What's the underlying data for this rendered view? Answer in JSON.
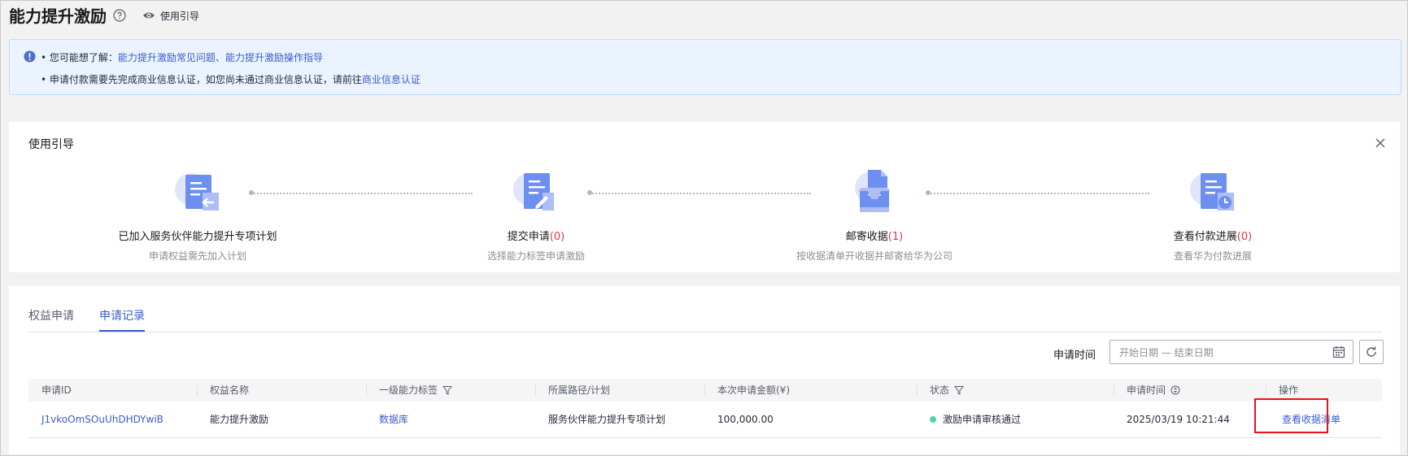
{
  "header": {
    "title": "能力提升激励",
    "guide_link": "使用引导"
  },
  "banner": {
    "line1_prefix": "• 您可能想了解：",
    "link_faq": "能力提升激励常见问题",
    "separator": "、",
    "link_guide": "能力提升激励操作指导",
    "line2_prefix": "• 申请付款需要先完成商业信息认证，如您尚未通过商业信息认证，请前往",
    "link_cert": "商业信息认证"
  },
  "guide": {
    "title": "使用引导",
    "steps": [
      {
        "title": "已加入服务伙伴能力提升专项计划",
        "count": "",
        "desc": "申请权益需先加入计划",
        "icon": "document-return-icon"
      },
      {
        "title": "提交申请",
        "count": "(0)",
        "desc": "选择能力标签申请激励",
        "icon": "document-edit-icon"
      },
      {
        "title": "邮寄收据",
        "count": "(1)",
        "desc": "按收据清单开收据并邮寄给华为公司",
        "icon": "mail-tray-icon"
      },
      {
        "title": "查看付款进展",
        "count": "(0)",
        "desc": "查看华为付款进展",
        "icon": "document-clock-icon"
      }
    ]
  },
  "tabs": [
    {
      "label": "权益申请",
      "active": false
    },
    {
      "label": "申请记录",
      "active": true
    }
  ],
  "filter": {
    "label": "申请时间",
    "placeholder": "开始日期 — 结束日期"
  },
  "table": {
    "columns": [
      "申请ID",
      "权益名称",
      "一级能力标签",
      "所属路径/计划",
      "本次申请金额(¥)",
      "状态",
      "申请时间",
      "操作"
    ],
    "rows": [
      {
        "id": "J1vkoOmSOuUhDHDYwiB",
        "benefit": "能力提升激励",
        "tag": "数据库",
        "plan": "服务伙伴能力提升专项计划",
        "amount": "100,000.00",
        "status": "激励申请审核通过",
        "time": "2025/03/19 10:21:44",
        "action": "查看收据清单"
      }
    ]
  },
  "colors": {
    "primary": "#3b5ccd",
    "status_success": "#50d4ab",
    "count_red": "#e0344a",
    "highlight_red": "#e8111b"
  }
}
